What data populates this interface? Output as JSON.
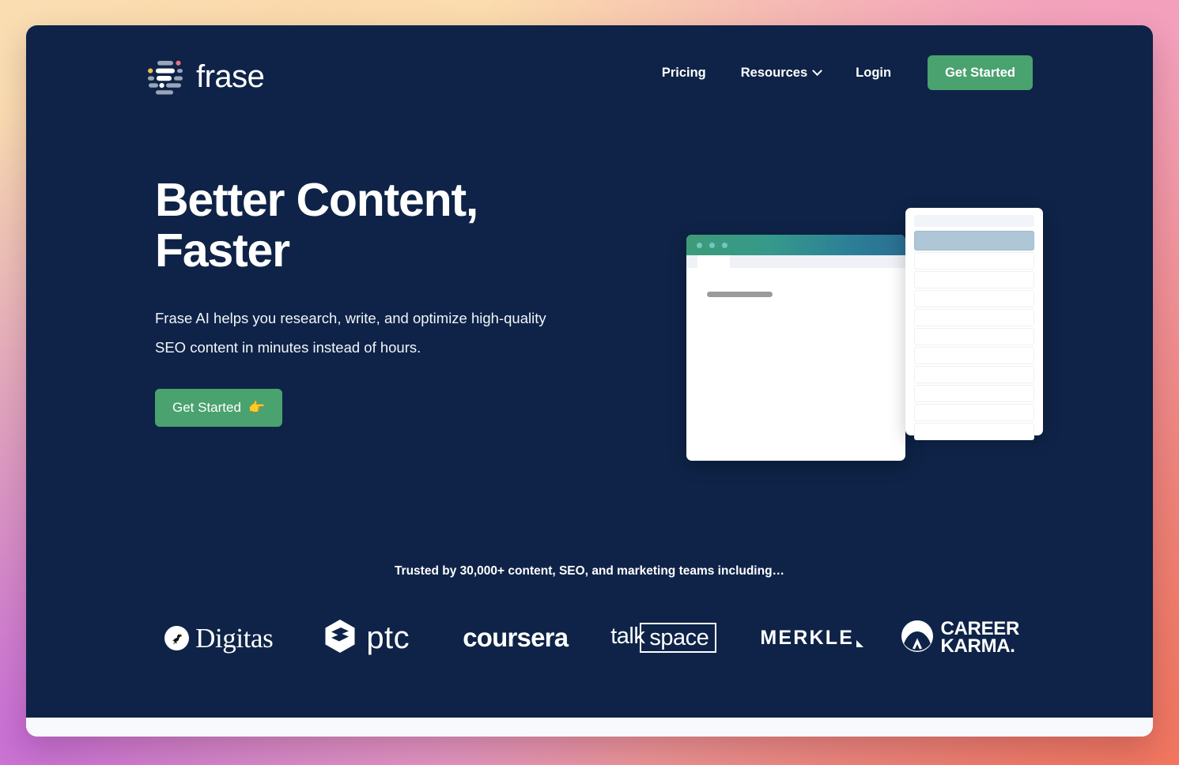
{
  "brand": {
    "name": "frase",
    "logo_icon": "frase-bars-logo-icon"
  },
  "colors": {
    "panel_background": "#0e2347",
    "accent_green": "#4aa26f",
    "text_white": "#ffffff",
    "titlebar_gradient_start": "#3e9b78",
    "titlebar_gradient_end": "#2a6f92",
    "page_background_gradient": "#fadfb4 #f0a9b7 #c86fd6 #f2765f"
  },
  "nav": {
    "links": [
      {
        "label": "Pricing",
        "has_dropdown": false
      },
      {
        "label": "Resources",
        "has_dropdown": true
      },
      {
        "label": "Login",
        "has_dropdown": false
      }
    ],
    "cta_label": "Get Started",
    "chevron_icon": "chevron-down-icon"
  },
  "hero": {
    "title_line1": "Better Content,",
    "title_line2": "Faster",
    "subtitle": "Frase AI helps you research, write, and optimize high-quality SEO content in minutes instead of hours.",
    "cta_label": "Get Started",
    "cta_emoji": "👉"
  },
  "illustration": {
    "window_dots": 3,
    "side_panel_rows": 12,
    "side_panel_active_row_index": 0
  },
  "social_proof": {
    "headline": "Trusted by 30,000+ content, SEO, and marketing teams including…",
    "logos": [
      {
        "name": "Digitas",
        "text": "Digitas",
        "icon": "digitas-unicorn-icon"
      },
      {
        "name": "ptc",
        "text": "ptc",
        "icon": "ptc-hexagon-icon"
      },
      {
        "name": "coursera",
        "text": "coursera",
        "icon": ""
      },
      {
        "name": "talkspace",
        "text_part1": "talk",
        "text_part2": "space",
        "icon": ""
      },
      {
        "name": "MERKLE",
        "text": "MERKLE",
        "icon": "merkle-triangle-icon"
      },
      {
        "name": "Career Karma",
        "text_line1": "CAREER",
        "text_line2": "KARMA.",
        "icon": "career-karma-arch-icon"
      }
    ]
  }
}
